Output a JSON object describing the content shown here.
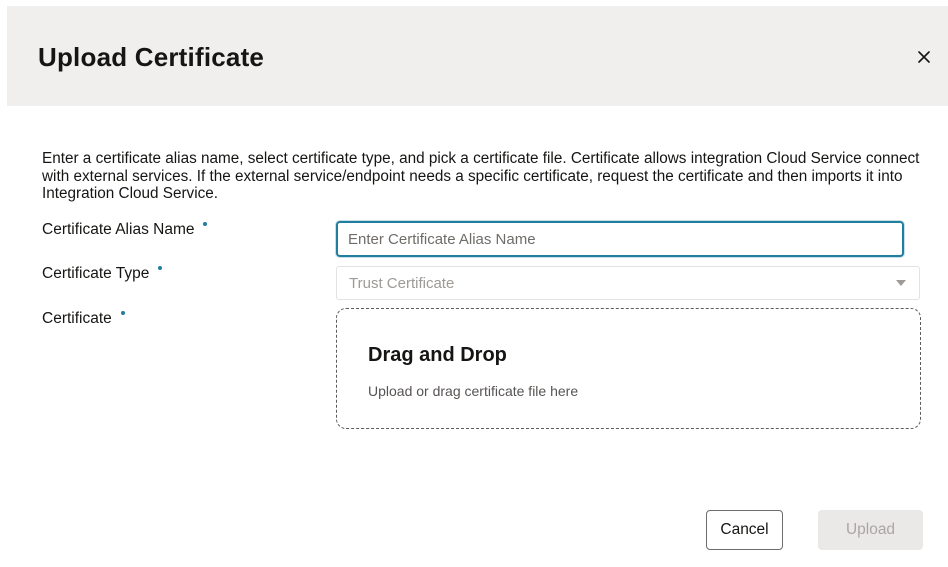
{
  "dialog": {
    "title": "Upload Certificate",
    "close_icon": "close-icon",
    "description": "Enter a certificate alias name, select certificate type, and pick a certificate file. Certificate allows integration Cloud Service connect with external services. If the external service/endpoint needs a specific certificate, request the certificate and then imports it into Integration Cloud Service."
  },
  "form": {
    "alias": {
      "label": "Certificate Alias Name",
      "value": "",
      "placeholder": "Enter Certificate Alias Name",
      "required": true
    },
    "type": {
      "label": "Certificate Type",
      "selected": "Trust Certificate",
      "required": true
    },
    "certificate": {
      "label": "Certificate",
      "required": true,
      "dropzone_title": "Drag and Drop",
      "dropzone_subtitle": "Upload or drag certificate file here"
    }
  },
  "footer": {
    "cancel_label": "Cancel",
    "upload_label": "Upload"
  },
  "colors": {
    "accent": "#227e9e",
    "header_bg": "#f1efed",
    "disabled_button_bg": "#ebe9e7"
  }
}
